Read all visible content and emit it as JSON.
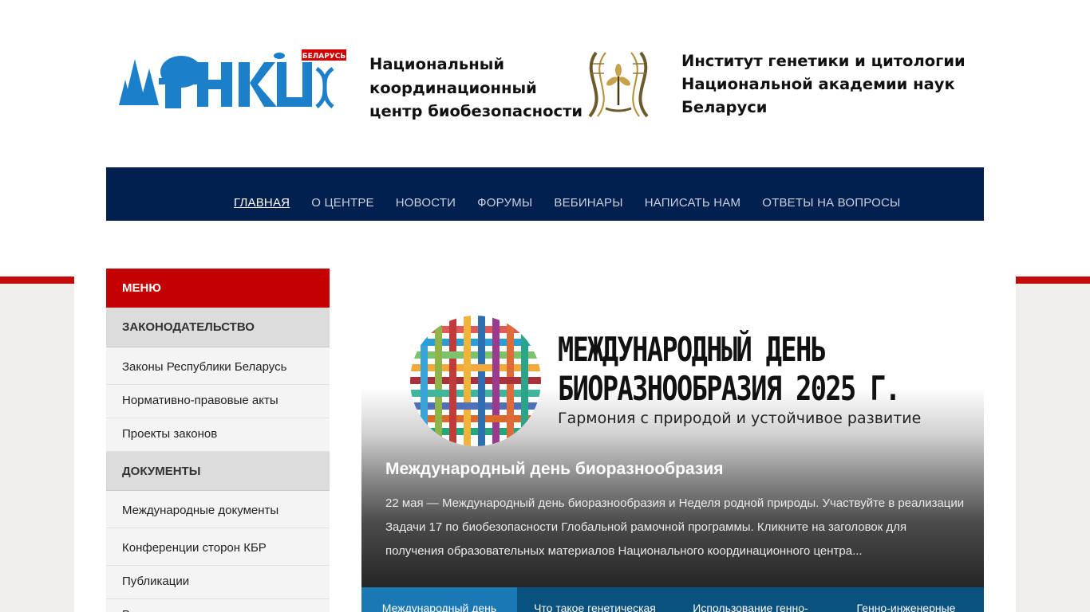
{
  "header": {
    "center_name_lines": [
      "Национальный",
      "координационный",
      "центр биобезопасности"
    ],
    "logo_badge": "БЕЛАРУСЬ",
    "institute_lines": [
      "Институт генетики и цитологии",
      "Национальной академии наук",
      "Беларуси"
    ]
  },
  "nav": {
    "items": [
      "ГЛАВНАЯ",
      "О ЦЕНТРЕ",
      "НОВОСТИ",
      "ФОРУМЫ",
      "ВЕБИНАРЫ",
      "НАПИСАТЬ НАМ",
      "ОТВЕТЫ НА ВОПРОСЫ"
    ],
    "active": "ГЛАВНАЯ"
  },
  "sidebar": {
    "menu_label": "МЕНЮ",
    "sections": [
      {
        "title": "ЗАКОНОДАТЕЛЬСТВО",
        "items": [
          "Законы Республики Беларусь",
          "Нормативно-правовые акты",
          "Проекты законов"
        ]
      },
      {
        "title": "ДОКУМЕНТЫ",
        "items": [
          "Международные документы",
          "Конференции сторон КБР",
          "Публикации",
          "В..."
        ]
      }
    ]
  },
  "slider": {
    "banner_line1": "МЕЖДУНАРОДНЫЙ ДЕНЬ",
    "banner_line2": "БИОРАЗНООБРАЗИЯ 2025 Г.",
    "banner_line3": "Гармония с природой и устойчивое развитие",
    "title": "Международный день биоразнообразия",
    "description": "22 мая — Международный день биоразнообразия и Неделя родной природы. Участвуйте в реализации Задачи 17 по биобезопасности Глобальной рамочной программы. Кликните на заголовок для получения образовательных материалов Национального координационного центра...",
    "tabs": [
      "Международный день",
      "Что такое генетическая",
      "Использование генно-",
      "Генно-инженерные"
    ]
  },
  "colors": {
    "nav_bg": "#02204f",
    "menu_red": "#c40000",
    "tab_bar": "#09517f",
    "tab_active": "#1a78b4"
  }
}
